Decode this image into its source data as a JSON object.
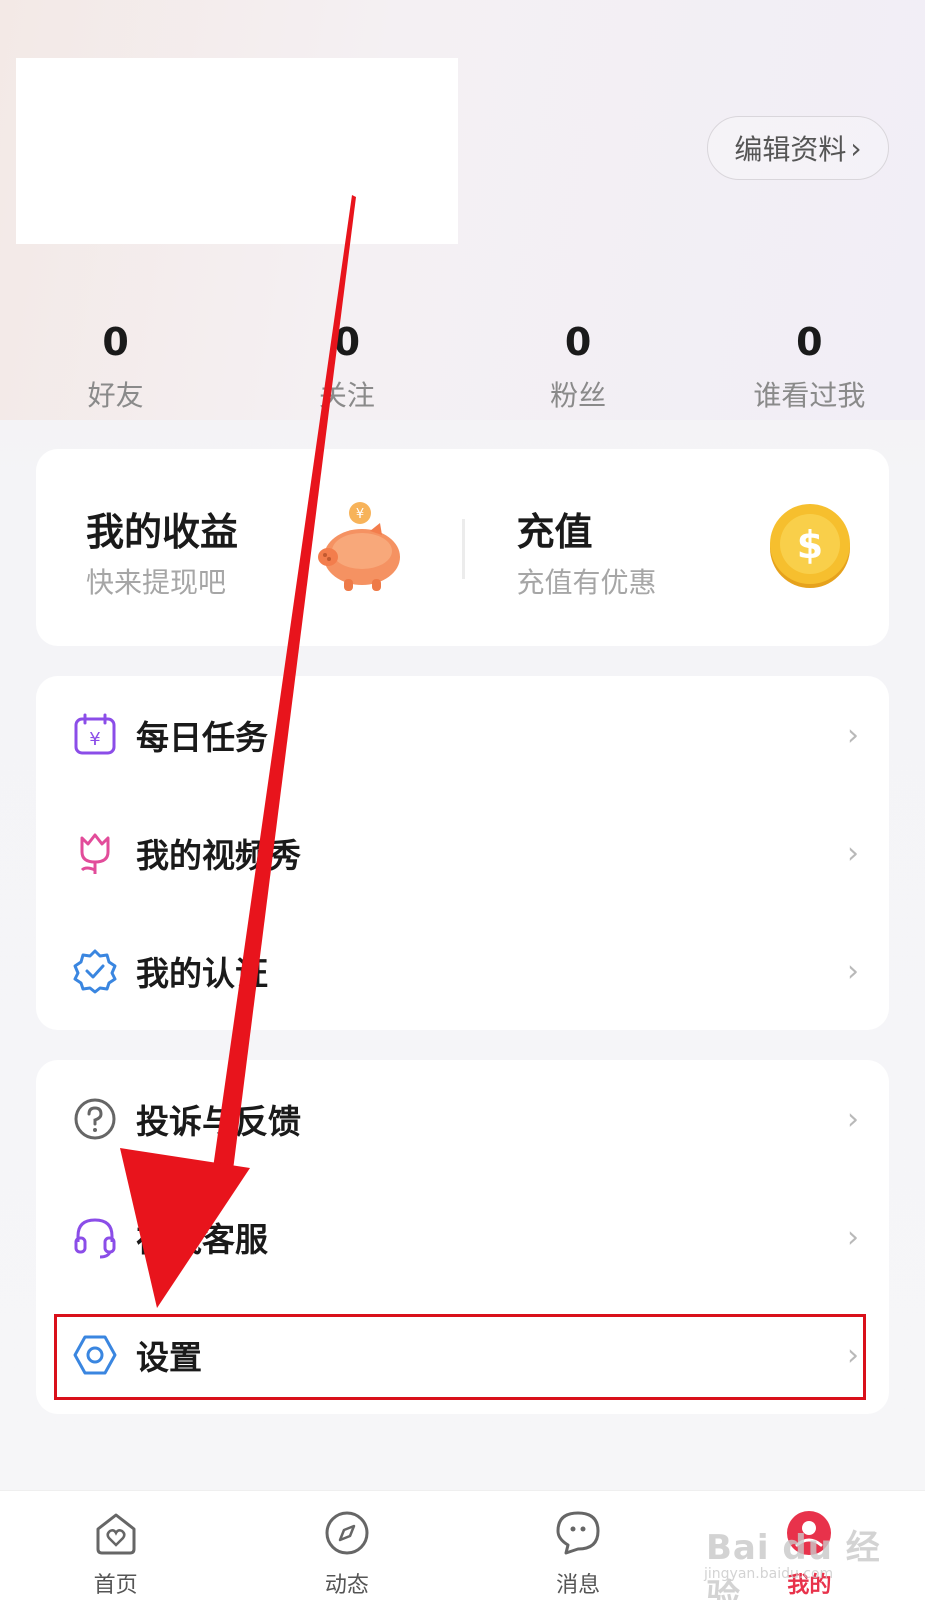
{
  "profile": {
    "edit_label": "编辑资料",
    "stats": [
      {
        "value": "0",
        "label": "好友"
      },
      {
        "value": "0",
        "label": "关注"
      },
      {
        "value": "0",
        "label": "粉丝"
      },
      {
        "value": "0",
        "label": "谁看过我"
      }
    ]
  },
  "earnings": {
    "left": {
      "title": "我的收益",
      "subtitle": "快来提现吧"
    },
    "right": {
      "title": "充值",
      "subtitle": "充值有优惠"
    }
  },
  "menu1": [
    {
      "label": "每日任务",
      "icon": "calendar-yen-icon"
    },
    {
      "label": "我的视频秀",
      "icon": "tulip-icon"
    },
    {
      "label": "我的认证",
      "icon": "verified-badge-icon"
    }
  ],
  "menu2": [
    {
      "label": "投诉与反馈",
      "icon": "help-circle-icon"
    },
    {
      "label": "在线客服",
      "icon": "headset-icon"
    },
    {
      "label": "设置",
      "icon": "settings-hexagon-icon"
    }
  ],
  "tabs": [
    {
      "label": "首页",
      "icon": "home-heart-icon",
      "active": false
    },
    {
      "label": "动态",
      "icon": "compass-icon",
      "active": false
    },
    {
      "label": "消息",
      "icon": "chat-bubble-icon",
      "active": false
    },
    {
      "label": "我的",
      "icon": "profile-icon",
      "active": true
    }
  ],
  "watermark": {
    "main": "Bai du 经验",
    "sub": "jingyan.baidu.com"
  },
  "colors": {
    "accent": "#e8324b",
    "annotation_red": "#d9101a"
  }
}
